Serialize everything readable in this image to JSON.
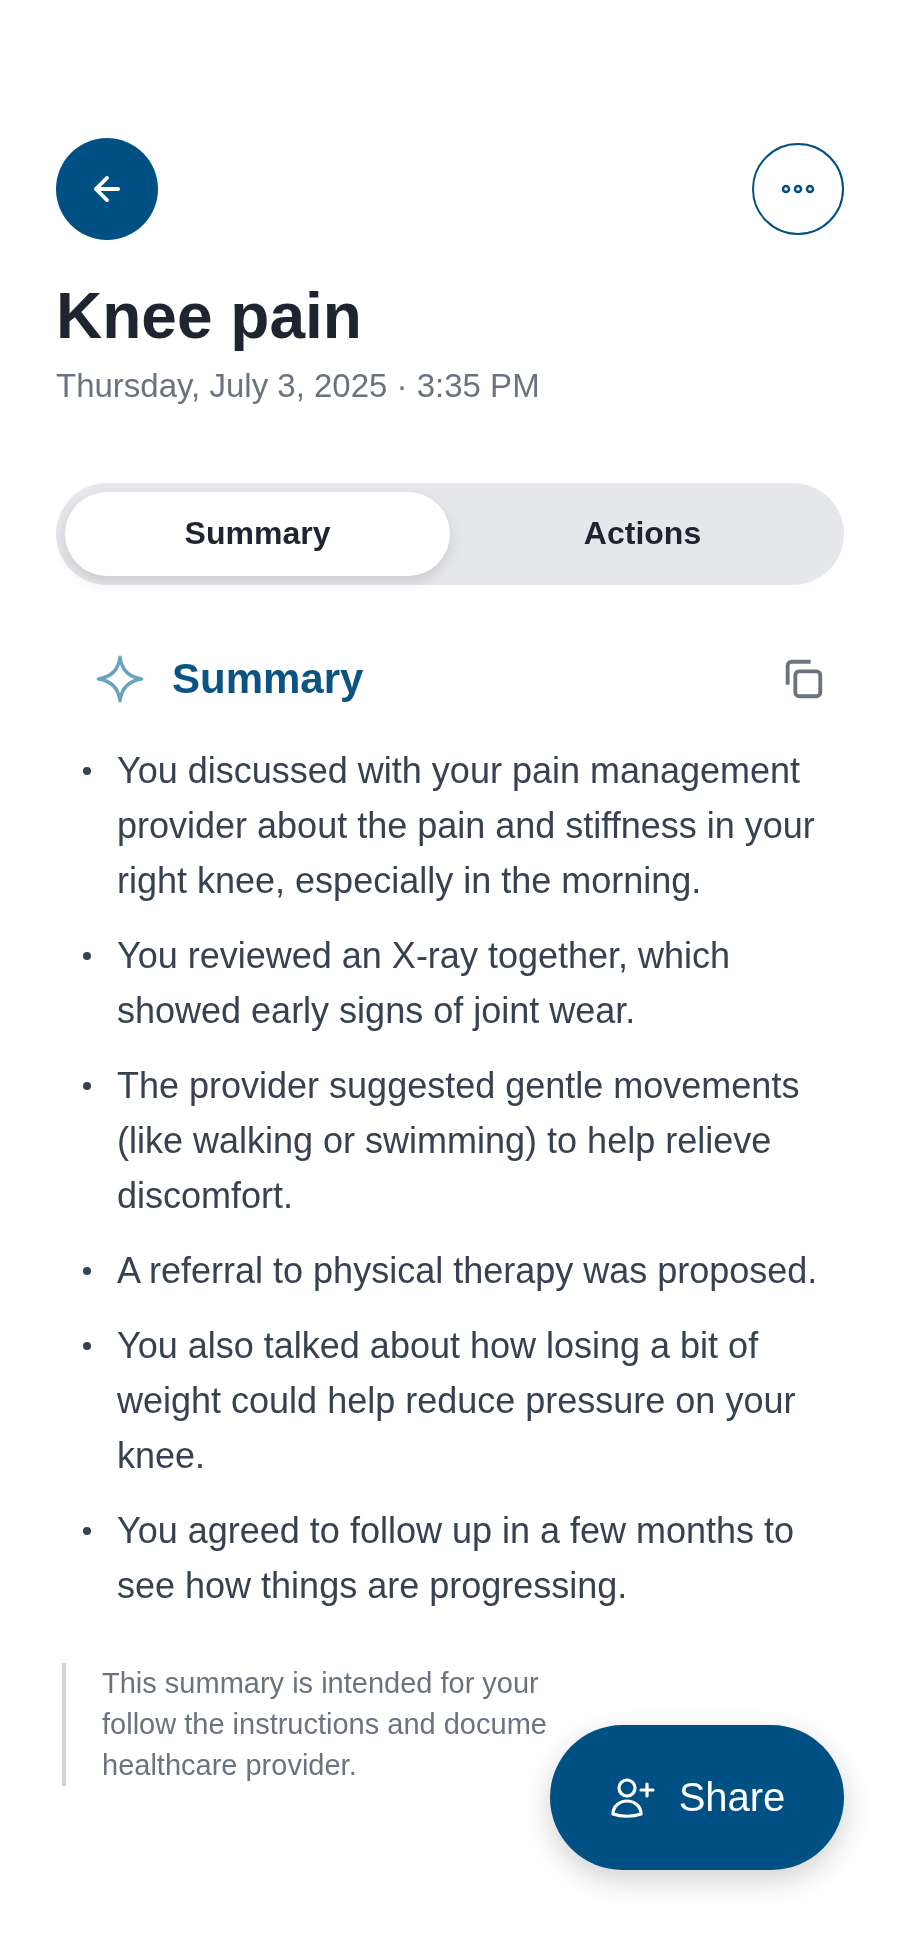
{
  "header": {
    "title": "Knee pain",
    "date": "Thursday, July 3, 2025 · 3:35 PM"
  },
  "tabs": [
    {
      "label": "Summary",
      "selected": true
    },
    {
      "label": "Actions",
      "selected": false
    }
  ],
  "summary": {
    "heading": "Summary",
    "items": [
      "You discussed with your pain management provider about the pain and stiffness in your right knee, especially in the morning.",
      "You reviewed an X-ray together, which showed early signs of joint wear.",
      "The provider suggested gentle movements (like walking or swimming) to help relieve discomfort.",
      "A referral to physical therapy was proposed.",
      "You also talked about how losing a bit of weight could help reduce pressure on your knee.",
      "You agreed to follow up in a few months to see how things are progressing."
    ]
  },
  "disclaimer": {
    "lines": [
      "This summary is intended for your",
      "follow the instructions and docume",
      "healthcare provider."
    ]
  },
  "share_button": {
    "label": "Share"
  }
}
